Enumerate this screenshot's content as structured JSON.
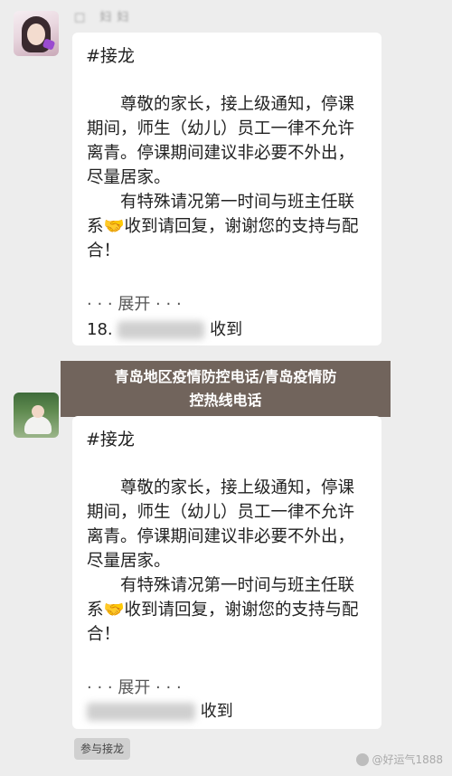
{
  "messages": [
    {
      "sender_name": "□ 妇妇",
      "tag": "#接龙",
      "body": "　　尊敬的家长，接上级通知，停课期间，师生（幼儿）员工一律不允许离青。停课期间建议非必要不外出，尽量居家。\n　　有特殊请况第一时间与班主任联系🤝收到请回复，谢谢您的支持与配合！",
      "expand_label": "· · · 展开 · · ·",
      "tail_prefix": "18.",
      "tail_suffix": "收到"
    },
    {
      "tag": "#接龙",
      "body": "　　尊敬的家长，接上级通知，停课期间，师生（幼儿）员工一律不允许离青。停课期间建议非必要不外出，尽量居家。\n　　有特殊请况第一时间与班主任联系🤝收到请回复，谢谢您的支持与配合！",
      "expand_label": "· · · 展开 · · ·",
      "tail_suffix": "收到"
    }
  ],
  "banner": {
    "line1": "青岛地区疫情防控电话/青岛疫情防",
    "line2": "控热线电话"
  },
  "join_button": "参与接龙",
  "watermark": "@好运气1888"
}
